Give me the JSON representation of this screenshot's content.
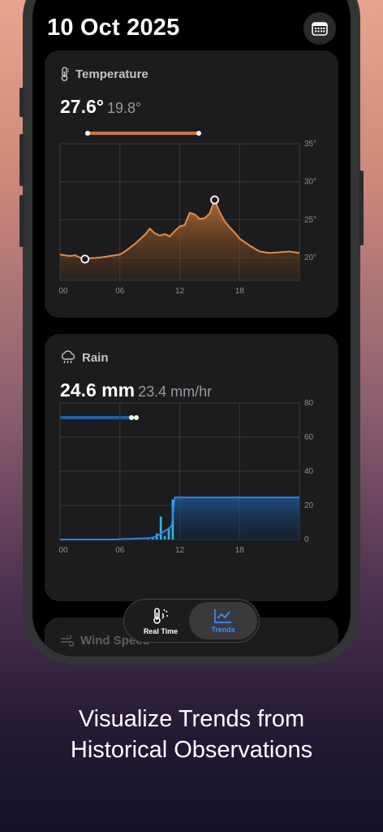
{
  "header": {
    "date": "10 Oct 2025"
  },
  "temperature": {
    "title": "Temperature",
    "current": "27.6°",
    "secondary": "19.8°",
    "chart_data": {
      "type": "area",
      "x_ticks": [
        "00",
        "06",
        "12",
        "18"
      ],
      "y_ticks": [
        "35°",
        "30°",
        "25°",
        "20°"
      ],
      "ylim": [
        17,
        35
      ],
      "xlim": [
        0,
        24
      ],
      "x": [
        0,
        0.5,
        1,
        1.5,
        2,
        2.5,
        3,
        4,
        5,
        6,
        6.5,
        7,
        7.5,
        8,
        8.5,
        9,
        9.5,
        10,
        10.5,
        11,
        11.5,
        12,
        12.5,
        13,
        13.5,
        14,
        14.5,
        15,
        15.5,
        16,
        16.5,
        17,
        17.5,
        18,
        19,
        20,
        21,
        22,
        23,
        24
      ],
      "y": [
        20.4,
        20.3,
        20.2,
        20.3,
        20.0,
        19.8,
        19.9,
        20.0,
        20.2,
        20.4,
        20.8,
        21.3,
        21.8,
        22.4,
        23.0,
        23.8,
        23.2,
        22.9,
        23.1,
        22.8,
        23.5,
        24.1,
        24.3,
        25.9,
        25.7,
        25.1,
        25.2,
        25.8,
        27.6,
        26.0,
        24.8,
        24.0,
        23.3,
        22.5,
        21.6,
        20.8,
        20.6,
        20.7,
        20.8,
        20.6
      ],
      "min_marker": {
        "x": 2.5,
        "y": 19.8
      },
      "max_marker": {
        "x": 15.5,
        "y": 27.6
      },
      "range_bar": {
        "min": 19.8,
        "max": 27.6
      },
      "colors": {
        "line": "#d98a4a",
        "range": "#c8783a"
      }
    }
  },
  "rain": {
    "title": "Rain",
    "current": "24.6 mm",
    "secondary": "23.4 mm/hr",
    "chart_data": {
      "type": "area",
      "x_ticks": [
        "00",
        "06",
        "12",
        "18"
      ],
      "y_ticks": [
        "80",
        "60",
        "40",
        "20",
        "0"
      ],
      "ylim": [
        0,
        80
      ],
      "xlim": [
        0,
        24
      ],
      "accumulated_x": [
        0,
        5.5,
        6,
        9,
        9.5,
        10,
        10.3,
        10.6,
        10.9,
        11.2,
        11.5,
        12,
        24
      ],
      "accumulated_y": [
        0,
        0,
        0.2,
        0.8,
        1.5,
        3.0,
        4.2,
        5.5,
        6.0,
        8.5,
        24.6,
        24.6,
        24.6
      ],
      "rate_x": [
        8.8,
        9.3,
        9.7,
        10.1,
        10.5,
        10.9,
        11.3
      ],
      "rate_y": [
        0.6,
        1.2,
        3.5,
        13.5,
        2.0,
        7.0,
        23.4
      ],
      "range_bar": {
        "min": 0,
        "max": 24.6
      },
      "colors": {
        "line": "#2a83e6",
        "bars": "#34b4e8",
        "range": "#1d5fa8"
      }
    }
  },
  "peek_card": {
    "title": "Wind Speed"
  },
  "tabs": [
    {
      "label": "Real Time",
      "icon": "weather-thermometer-icon"
    },
    {
      "label": "Trends",
      "icon": "trend-chart-icon"
    }
  ],
  "caption": {
    "line1": "Visualize Trends from",
    "line2": "Historical Observations"
  }
}
